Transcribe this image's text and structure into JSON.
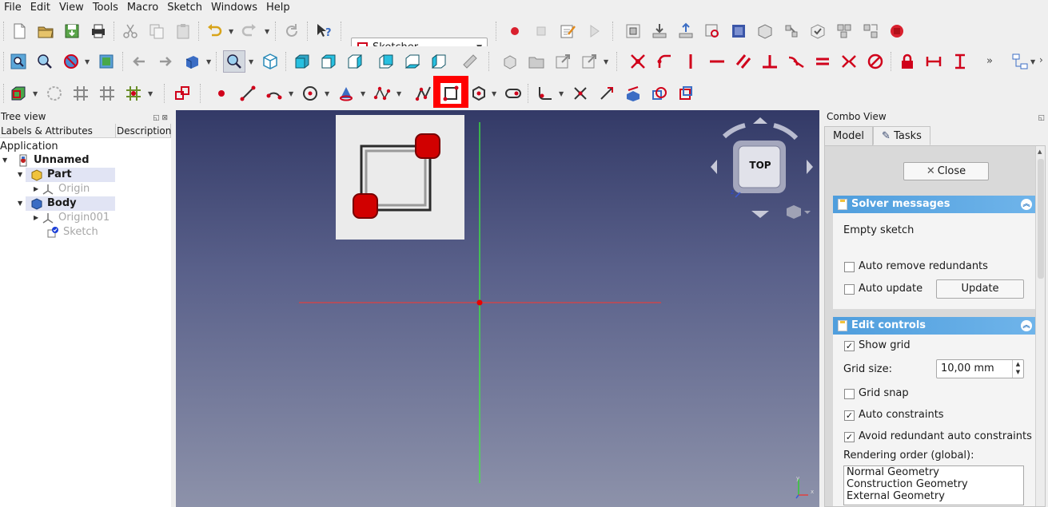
{
  "menu": [
    "File",
    "Edit",
    "View",
    "Tools",
    "Macro",
    "Sketch",
    "Windows",
    "Help"
  ],
  "workbench": {
    "selected": "Sketcher"
  },
  "tree": {
    "title": "Tree view",
    "columns": [
      "Labels & Attributes",
      "Description"
    ],
    "root": "Application",
    "items": [
      {
        "label": "Unnamed"
      },
      {
        "label": "Part"
      },
      {
        "label": "Origin"
      },
      {
        "label": "Body"
      },
      {
        "label": "Origin001"
      },
      {
        "label": "Sketch"
      }
    ]
  },
  "navcube": {
    "face": "TOP"
  },
  "combo": {
    "title": "Combo View",
    "tabs": [
      "Model",
      "Tasks"
    ],
    "close_label": "Close",
    "solver": {
      "title": "Solver messages",
      "message": "Empty sketch",
      "auto_remove": {
        "label": "Auto remove redundants",
        "checked": false
      },
      "auto_update": {
        "label": "Auto update",
        "checked": false
      },
      "update_label": "Update"
    },
    "edit": {
      "title": "Edit controls",
      "show_grid": {
        "label": "Show grid",
        "checked": true
      },
      "grid_size_label": "Grid size:",
      "grid_size_value": "10,00 mm",
      "grid_snap": {
        "label": "Grid snap",
        "checked": false
      },
      "auto_constraints": {
        "label": "Auto constraints",
        "checked": true
      },
      "avoid_redundant": {
        "label": "Avoid redundant auto constraints",
        "checked": true
      },
      "rendering_label": "Rendering order (global):",
      "rendering_items": [
        "Normal Geometry",
        "Construction Geometry",
        "External Geometry"
      ]
    }
  },
  "colors": {
    "accent_red": "#d0021b",
    "highlight": "#ff0000",
    "panel_blue": "#4f9edd",
    "axis_green": "#3cf03c",
    "axis_red": "#e04040"
  }
}
